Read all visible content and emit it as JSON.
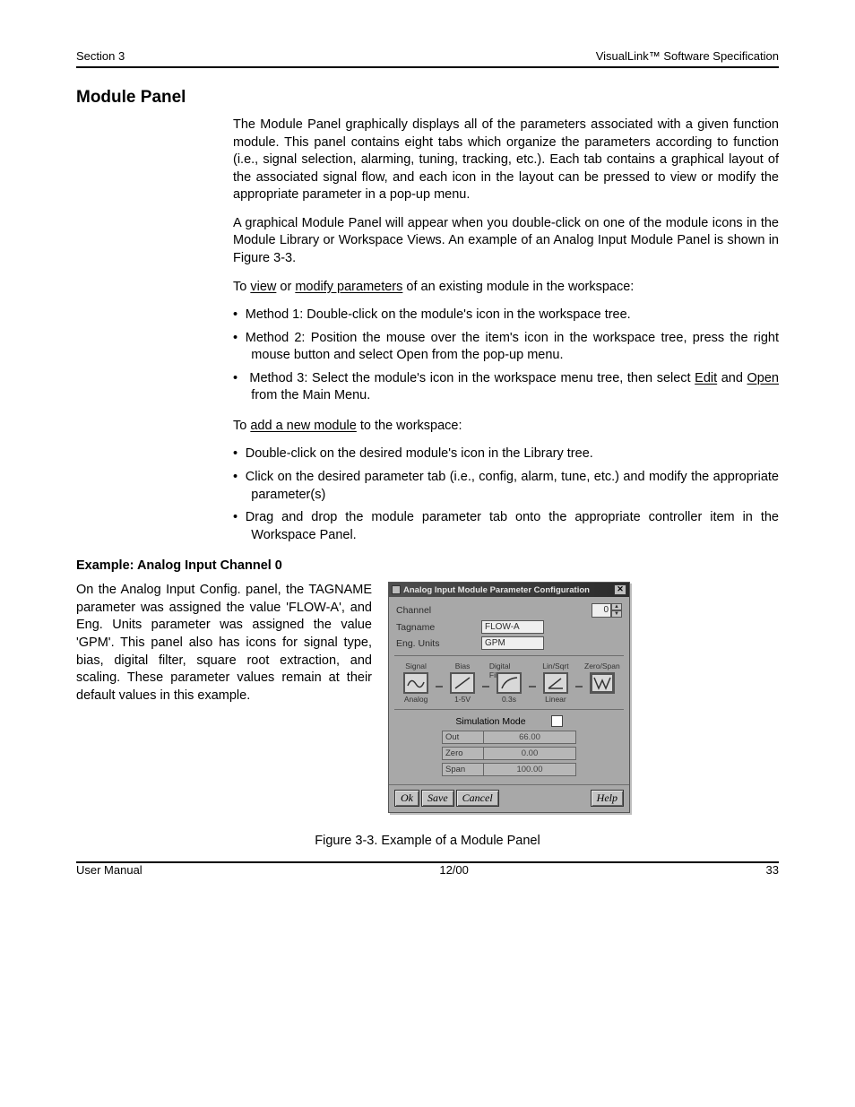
{
  "page": {
    "header_left": "Section 3",
    "header_right": "VisualLink™ Software Specification",
    "footer_left": "User Manual",
    "footer_center": "12/00",
    "footer_right": "33"
  },
  "sec_a": {
    "heading": "Module Panel",
    "p1": "The Module Panel graphically displays all of the parameters associated with a given function module. This panel contains eight tabs which organize the parameters according to function (i.e., signal selection, alarming, tuning, tracking, etc.). Each tab contains a graphical layout of the associated signal flow, and each icon in the layout can be pressed to view or modify the appropriate parameter in a pop-up menu.",
    "p2": "A graphical Module Panel will appear when you double-click on one of the module icons in the Module Library or Workspace Views. An example of an Analog Input Module Panel is shown in Figure 3-3.",
    "p3_a": "To ",
    "p3_view": "view",
    "p3_b": " or ",
    "p3_modify": "modify parameters",
    "p3_c": " of an existing module in the workspace:"
  },
  "list": {
    "i1": "Method 1: Double-click on the module's icon in the workspace tree.",
    "i2": "Method 2: Position the mouse over the item's icon in the workspace tree, press the right mouse button and select Open from the pop-up menu.",
    "i3_a": "Method 3: Select the module's icon in the workspace menu tree, then select ",
    "i3_edit": "Edit",
    "i3_b": " and ",
    "i3_open": "Open",
    "i3_c": " from the Main Menu."
  },
  "sec_b": {
    "p4_a": "To ",
    "p4_new": "add a new module",
    "p4_b": " to the workspace:",
    "l1": "Double-click on the desired module's icon in the Library tree.",
    "l2": "Click on the desired parameter tab (i.e., config, alarm, tune, etc.) and modify the appropriate parameter(s)",
    "l3": "Drag and drop the module parameter tab onto the appropriate controller item in the Workspace Panel."
  },
  "example_label": "Example:  Analog Input Channel 0",
  "example_text": "On the Analog Input Config. panel, the TAGNAME parameter was assigned the value 'FLOW-A', and Eng. Units parameter was assigned the value 'GPM'. This panel also has icons for signal type, bias, digital filter, square root extraction, and scaling. These parameter values remain at their default values in this example.",
  "dialog": {
    "title": "Analog Input Module Parameter Configuration",
    "labels": {
      "channel": "Channel",
      "tagname": "Tagname",
      "units": "Eng.  Units",
      "sim": "Simulation Mode"
    },
    "values": {
      "channel": "0",
      "tagname": "FLOW-A",
      "units": "GPM"
    },
    "icons": {
      "c1_top": "Signal",
      "c1_bot": "Analog",
      "c2_top": "Bias",
      "c2_bot": "1-5V",
      "c3_top": "Digital Filter",
      "c3_bot": "0.3s",
      "c4_top": "Lin/Sqrt",
      "c4_bot": "Linear",
      "c5_top": "Zero/Span",
      "c5_bot": ""
    },
    "rows": {
      "out_k": "Out",
      "out_v": "66.00",
      "zero_k": "Zero",
      "zero_v": "0.00",
      "span_k": "Span",
      "span_v": "100.00"
    },
    "buttons": {
      "ok": "Ok",
      "save": "Save",
      "cancel": "Cancel",
      "help": "Help"
    }
  },
  "figcap": "Figure 3-3.  Example of a Module Panel"
}
